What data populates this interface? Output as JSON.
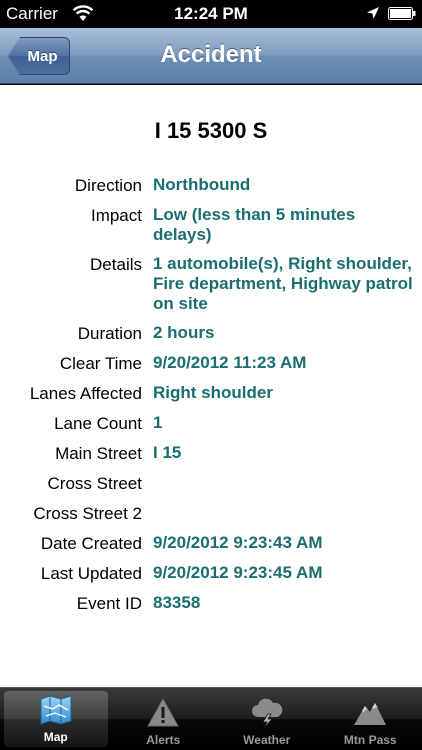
{
  "status_bar": {
    "carrier": "Carrier",
    "time": "12:24 PM",
    "icons": [
      "wifi-icon",
      "location-arrow-icon",
      "battery-icon"
    ]
  },
  "nav": {
    "back_label": "Map",
    "title": "Accident"
  },
  "detail": {
    "heading": "I 15 5300 S",
    "rows": [
      {
        "label": "Direction",
        "value": "Northbound"
      },
      {
        "label": "Impact",
        "value": "Low (less than 5 minutes delays)"
      },
      {
        "label": "Details",
        "value": "1 automobile(s), Right shoulder, Fire department, Highway patrol on site"
      },
      {
        "label": "Duration",
        "value": "2 hours"
      },
      {
        "label": "Clear Time",
        "value": "9/20/2012 11:23 AM"
      },
      {
        "label": "Lanes Affected",
        "value": "Right shoulder"
      },
      {
        "label": "Lane Count",
        "value": "1"
      },
      {
        "label": "Main Street",
        "value": "I 15"
      },
      {
        "label": "Cross Street",
        "value": ""
      },
      {
        "label": "Cross Street 2",
        "value": ""
      },
      {
        "label": "Date Created",
        "value": "9/20/2012 9:23:43 AM"
      },
      {
        "label": "Last Updated",
        "value": "9/20/2012 9:23:45 AM"
      },
      {
        "label": "Event ID",
        "value": "83358"
      }
    ]
  },
  "tabs": [
    {
      "label": "Map",
      "icon": "map-icon",
      "active": true
    },
    {
      "label": "Alerts",
      "icon": "warning-icon",
      "active": false
    },
    {
      "label": "Weather",
      "icon": "storm-cloud-icon",
      "active": false
    },
    {
      "label": "Mtn Pass",
      "icon": "mountain-icon",
      "active": false
    }
  ],
  "colors": {
    "value_text": "#1a6e70",
    "nav_bar": "#7e9cbf"
  }
}
